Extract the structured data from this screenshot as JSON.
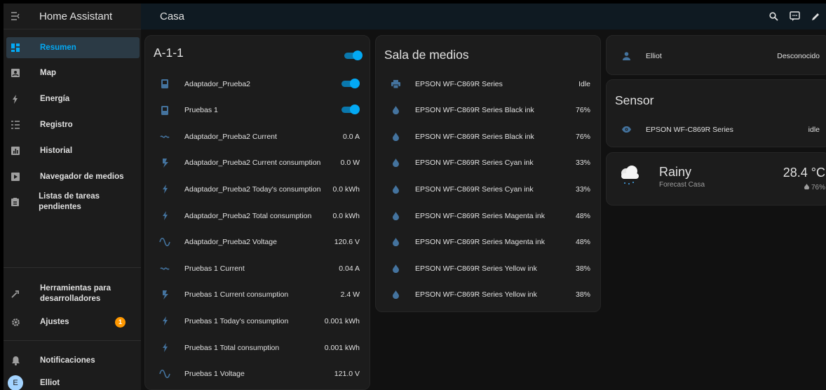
{
  "sidebar": {
    "app_title": "Home Assistant",
    "items": [
      {
        "label": "Resumen",
        "icon": "dashboard-icon",
        "active": true
      },
      {
        "label": "Map",
        "icon": "map-icon"
      },
      {
        "label": "Energía",
        "icon": "lightning-icon"
      },
      {
        "label": "Registro",
        "icon": "logbook-icon"
      },
      {
        "label": "Historial",
        "icon": "chart-icon"
      },
      {
        "label": "Navegador de medios",
        "icon": "media-icon"
      },
      {
        "label": "Listas de tareas pendientes",
        "icon": "clipboard-icon"
      }
    ],
    "dev_tools": "Herramientas para desarrolladores",
    "dev_tools_line1": "Herramientas para",
    "dev_tools_line2": "desarrolladores",
    "settings": "Ajustes",
    "settings_badge": "1",
    "notifications": "Notificaciones",
    "user": "Elliot",
    "user_initial": "E"
  },
  "topbar": {
    "title": "Casa"
  },
  "cards": {
    "a11": {
      "title": "A-1-1",
      "rows": [
        {
          "name": "Adaptador_Prueba2",
          "type": "toggle",
          "on": true
        },
        {
          "name": "Pruebas 1",
          "type": "toggle",
          "on": true
        },
        {
          "name": "Adaptador_Prueba2 Current",
          "value": "0.0 A",
          "icon": "current-icon"
        },
        {
          "name": "Adaptador_Prueba2 Current consumption",
          "value": "0.0 W",
          "icon": "flash-icon"
        },
        {
          "name": "Adaptador_Prueba2 Today's consumption",
          "value": "0.0 kWh",
          "icon": "lightning-icon"
        },
        {
          "name": "Adaptador_Prueba2 Total consumption",
          "value": "0.0 kWh",
          "icon": "lightning-icon"
        },
        {
          "name": "Adaptador_Prueba2 Voltage",
          "value": "120.6 V",
          "icon": "sine-wave-icon"
        },
        {
          "name": "Pruebas 1 Current",
          "value": "0.04 A",
          "icon": "current-icon"
        },
        {
          "name": "Pruebas 1 Current consumption",
          "value": "2.4 W",
          "icon": "flash-icon"
        },
        {
          "name": "Pruebas 1 Today's consumption",
          "value": "0.001 kWh",
          "icon": "lightning-icon"
        },
        {
          "name": "Pruebas 1 Total consumption",
          "value": "0.001 kWh",
          "icon": "lightning-icon"
        },
        {
          "name": "Pruebas 1 Voltage",
          "value": "121.0 V",
          "icon": "sine-wave-icon"
        }
      ]
    },
    "media": {
      "title": "Sala de medios",
      "rows": [
        {
          "name": "EPSON WF-C869R Series",
          "value": "Idle",
          "icon": "printer-icon"
        },
        {
          "name": "EPSON WF-C869R Series Black ink",
          "value": "76%",
          "icon": "water-drop-icon"
        },
        {
          "name": "EPSON WF-C869R Series Black ink",
          "value": "76%",
          "icon": "water-drop-icon"
        },
        {
          "name": "EPSON WF-C869R Series Cyan ink",
          "value": "33%",
          "icon": "water-drop-icon"
        },
        {
          "name": "EPSON WF-C869R Series Cyan ink",
          "value": "33%",
          "icon": "water-drop-icon"
        },
        {
          "name": "EPSON WF-C869R Series Magenta ink",
          "value": "48%",
          "icon": "water-drop-icon"
        },
        {
          "name": "EPSON WF-C869R Series Magenta ink",
          "value": "48%",
          "icon": "water-drop-icon"
        },
        {
          "name": "EPSON WF-C869R Series Yellow ink",
          "value": "38%",
          "icon": "water-drop-icon"
        },
        {
          "name": "EPSON WF-C869R Series Yellow ink",
          "value": "38%",
          "icon": "water-drop-icon"
        }
      ]
    },
    "person": {
      "name": "Elliot",
      "value": "Desconocido",
      "icon": "account-icon"
    },
    "sensor": {
      "title": "Sensor",
      "name": "EPSON WF-C869R Series",
      "value": "idle",
      "icon": "eye-icon"
    },
    "weather": {
      "condition": "Rainy",
      "forecast": "Forecast Casa",
      "temperature": "28.4 °C",
      "humidity": "76%"
    }
  },
  "colors": {
    "accent": "#03a9f4",
    "icon": "#44739e",
    "badge": "#ff9800",
    "card": "#1c1c1c",
    "background": "#111111"
  }
}
